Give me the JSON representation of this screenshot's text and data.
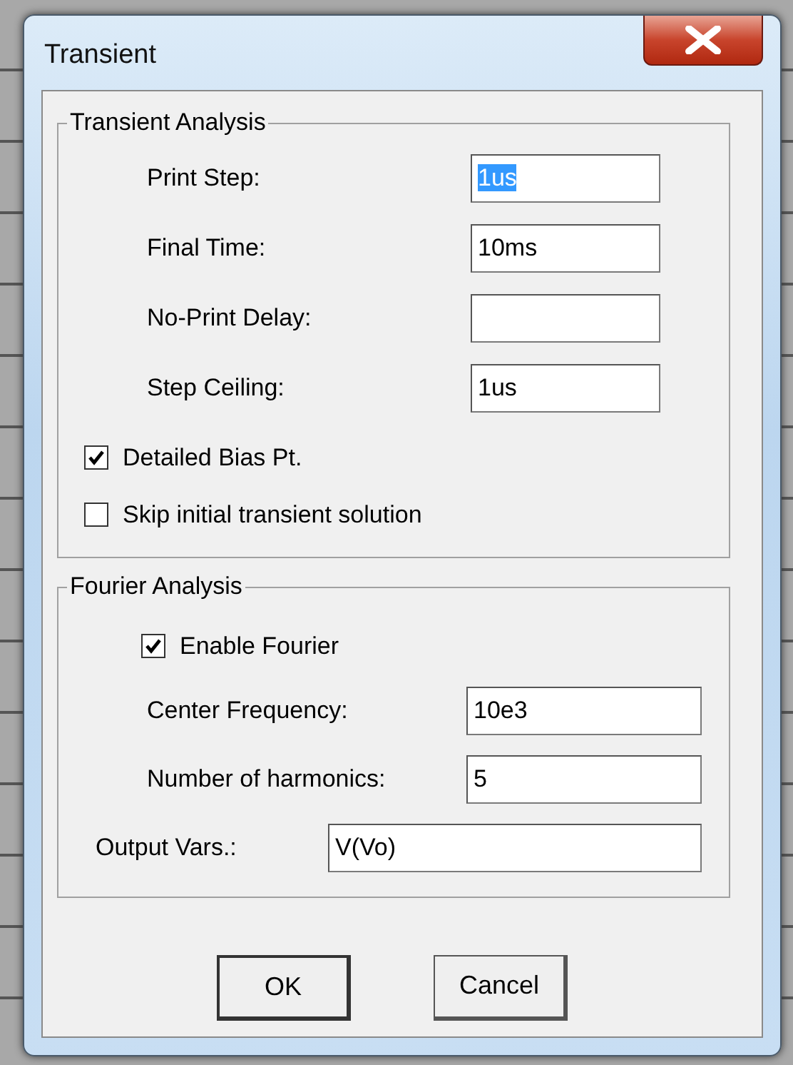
{
  "window": {
    "title": "Transient"
  },
  "transient": {
    "title": "Transient Analysis",
    "fields": [
      {
        "label": "Print Step:",
        "value": "1us",
        "highlighted": true
      },
      {
        "label": "Final Time:",
        "value": "10ms",
        "highlighted": false
      },
      {
        "label": "No-Print Delay:"
      },
      {
        "label": "Step Ceiling:",
        "value": "1us",
        "highlighted": false
      }
    ],
    "checkboxes": [
      {
        "label": "Detailed Bias Pt.",
        "checked": true
      },
      {
        "label": "Skip initial transient solution",
        "checked": false
      }
    ]
  },
  "fourier": {
    "title": "Fourier Analysis",
    "enable": {
      "label": "Enable Fourier",
      "checked": true
    },
    "fields": [
      {
        "kind": "short",
        "label": "Center Frequency:",
        "value": "10e3"
      },
      {
        "kind": "short",
        "label": "Number of harmonics:",
        "value": "5"
      },
      {
        "kind": "wide",
        "label": "Output Vars.:",
        "value": "V(Vo)"
      }
    ]
  },
  "buttons": [
    {
      "label": "OK",
      "default": true
    },
    {
      "label": "Cancel",
      "default": false
    }
  ]
}
